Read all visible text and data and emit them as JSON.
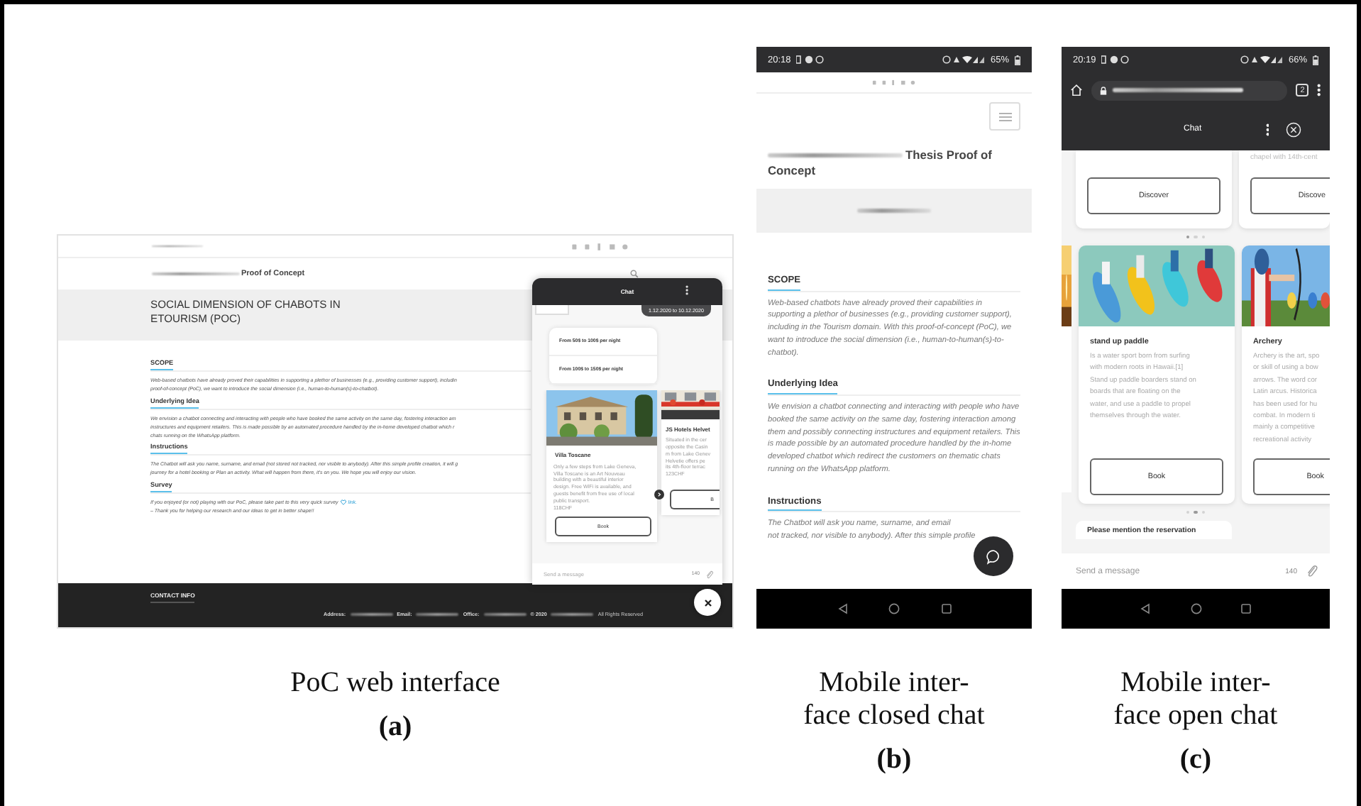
{
  "web_panel": {
    "site_title": "Proof of Concept",
    "page_title": "SOCIAL DIMENSION OF CHABOTS IN ETOURISM (POC)",
    "sections": [
      {
        "heading": "SCOPE",
        "lines": [
          {
            "text": "Web-based chatbots have already proved their capabilities in supporting a plethor of businesses (e.g., providing customer support), includin"
          },
          {
            "text": "proof-of-concept (PoC), we want to introduce the social dimension (i.e., human-to-human(s)-to-chatbot)."
          }
        ]
      },
      {
        "heading": "Underlying Idea",
        "lines": [
          {
            "text": "We envision a chatbot connecting and interacting with people who have booked the same activity on the same day, fostering interaction am"
          },
          {
            "text": "instructures and equipment retailers. This is made possible by an automated procedure handled by the in-home developed chatbot which r"
          },
          {
            "text": "chats running on the WhatsApp platform."
          }
        ]
      },
      {
        "heading": "Instructions",
        "lines": [
          {
            "text": "The Chatbot will ask you name, surname, and email (not stored not tracked, nor visible to anybody). After this simple profile creation, it will g"
          },
          {
            "text": "journey for a hotel booking or Plan an activity. What will happen from there, it's on you. We hope you will enjoy our vision."
          }
        ]
      },
      {
        "heading": "Survey",
        "lines": [
          {
            "text": "If you enjoyed (or not) playing with our PoC, please take part to this very quick survey",
            "link": "link."
          },
          {
            "text": "– Thank you for helping our research and our ideas to get in better shape!!"
          }
        ]
      }
    ],
    "footer": {
      "heading": "CONTACT INFO",
      "fields": [
        "Address:",
        "Email:",
        "Office:",
        "© 2020"
      ],
      "rights": "All Rights Reserved"
    },
    "chat": {
      "title": "Chat",
      "date": "1.12.2020 to 10.12.2020",
      "quick_replies": [
        "From 50$ to 100$ per night",
        "From 100$ to 150$ per night"
      ],
      "cards": [
        {
          "title": "Villa Toscane",
          "lines": [
            "Only a few steps from Lake Geneva,",
            "Villa Toscane is an Art Nouveau",
            "building with a beautiful interior",
            "design. Free WiFi is available, and",
            "guests benefit from free use of local",
            "public transport.",
            "118CHF"
          ],
          "button": "Book"
        },
        {
          "title": "JS Hotels Helvet",
          "lines": [
            "Situated in the cer",
            "opposite the Casin",
            "m from Lake Genev",
            "Helvetie offers pe",
            "its 4th-floor terrac",
            "123CHF"
          ],
          "button": "B"
        }
      ],
      "input": {
        "placeholder": "Send a message"
      },
      "counter": "140"
    },
    "caption": {
      "lines": [
        "PoC web interface"
      ],
      "label": "(a)"
    }
  },
  "mobile_closed_panel": {
    "status_bar": {
      "time": "20:18",
      "battery": "65%"
    },
    "title_lines": [
      "Thesis Proof of",
      "Concept"
    ],
    "sections": [
      {
        "heading": "SCOPE",
        "text": "Web-based chatbots have already proved their capabilities in supporting a plethor of businesses (e.g., providing customer support), including in the Tourism domain. With this proof-of-concept (PoC), we want to introduce the social dimension (i.e., human-to-human(s)-to-chatbot)."
      },
      {
        "heading": "Underlying Idea",
        "text": "We envision a chatbot connecting and interacting with people who have booked the same activity on the same day, fostering interaction among them and possibly connecting instructures and equipment retailers. This is made possible by an automated procedure handled by the in-home developed chatbot which redirect the customers on thematic chats running on the WhatsApp platform."
      },
      {
        "heading": "Instructions",
        "text": "The Chatbot will ask you name, surname, and email",
        "more": "not tracked, nor visible to anybody). After this simple profile"
      }
    ],
    "caption": {
      "lines": [
        "Mobile inter-",
        "face closed chat"
      ],
      "label": "(b)"
    }
  },
  "mobile_open_panel": {
    "status_bar": {
      "time": "20:19",
      "battery": "66%"
    },
    "tab_count": "2",
    "chat_title": "Chat",
    "top_cards": [
      {
        "button": "Discover"
      },
      {
        "text": "chapel with 14th-cent",
        "button": "Discove"
      }
    ],
    "top_dots": [
      {
        "selected": true
      },
      {
        "selected": false
      },
      {
        "selected": false
      }
    ],
    "activity_cards": [
      {
        "title": "stand up paddle",
        "lines": [
          "Is a water sport born from surfing",
          "with modern roots in Hawaii.[1]",
          "Stand up paddle boarders stand on",
          "boards that are floating on the",
          "water, and use a paddle to propel",
          "themselves through the water."
        ],
        "button": "Book"
      },
      {
        "title": "Archery",
        "lines": [
          "Archery is the art, spo",
          "or skill of using a bow",
          "arrows. The word cor",
          "Latin arcus. Historica",
          "has been used for hu",
          "combat. In modern ti",
          "mainly a competitive",
          "recreational activity"
        ],
        "button": "Book"
      }
    ],
    "bottom_dots": [
      {
        "selected": false
      },
      {
        "selected": true
      },
      {
        "selected": false
      }
    ],
    "message": "Please mention the reservation",
    "input": {
      "placeholder": "Send a message"
    },
    "counter": "140",
    "caption": {
      "lines": [
        "Mobile inter-",
        "face open chat"
      ],
      "label": "(c)"
    }
  }
}
